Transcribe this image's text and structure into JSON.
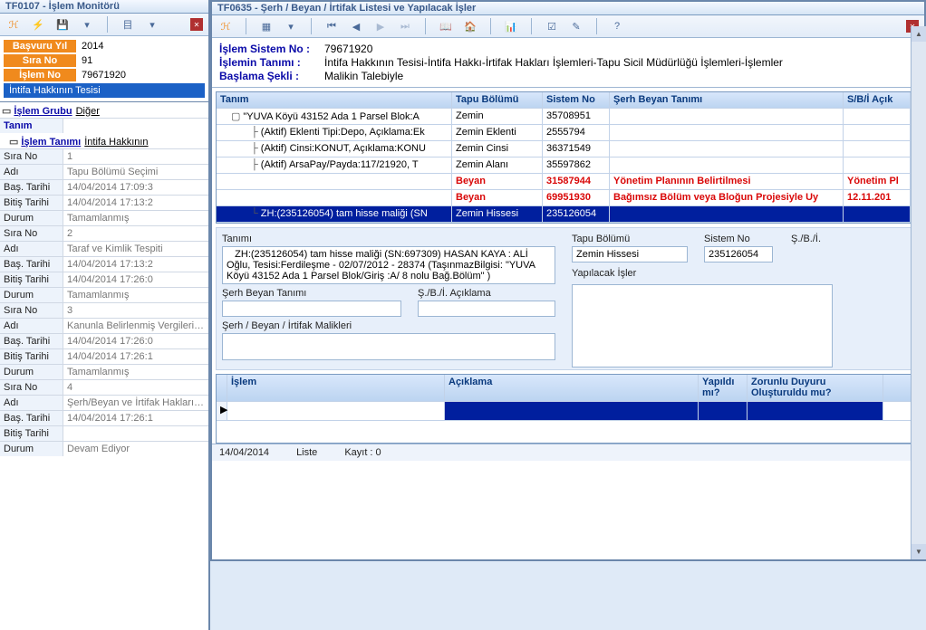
{
  "leftWindow": {
    "title": "TF0107 - İşlem Monitörü",
    "header": {
      "k1": "Başvuru Yıl",
      "v1": "2014",
      "k2": "Sıra No",
      "v2": "91",
      "k3": "İşlem No",
      "v3": "79671920",
      "statusBanner": "İntifa Hakkının Tesisi"
    },
    "groupLabel1": "İşlem Grubu",
    "groupVal1": "Diğer",
    "tanimKey": "Tanım",
    "groupLabel2": "İşlem Tanımı",
    "groupVal2": "İntifa Hakkının",
    "items": [
      {
        "f": [
          [
            "Sıra No",
            "1"
          ],
          [
            "Adı",
            "Tapu Bölümü Seçimi"
          ],
          [
            "Baş. Tarihi",
            "14/04/2014 17:09:3"
          ],
          [
            "Bitiş Tarihi",
            "14/04/2014 17:13:2"
          ],
          [
            "Durum",
            "Tamamlanmış"
          ]
        ]
      },
      {
        "f": [
          [
            "Sıra No",
            "2"
          ],
          [
            "Adı",
            "Taraf ve Kimlik Tespiti"
          ],
          [
            "Baş. Tarihi",
            "14/04/2014 17:13:2"
          ],
          [
            "Bitiş Tarihi",
            "14/04/2014 17:26:0"
          ],
          [
            "Durum",
            "Tamamlanmış"
          ]
        ]
      },
      {
        "f": [
          [
            "Sıra No",
            "3"
          ],
          [
            "Adı",
            "Kanunla Belirlenmiş Vergilerin Kontrolü"
          ],
          [
            "Baş. Tarihi",
            "14/04/2014 17:26:0"
          ],
          [
            "Bitiş Tarihi",
            "14/04/2014 17:26:1"
          ],
          [
            "Durum",
            "Tamamlanmış"
          ]
        ]
      },
      {
        "f": [
          [
            "Sıra No",
            "4"
          ],
          [
            "Adı",
            "Şerh/Beyan ve İrtifak Hakları Kontrolü"
          ],
          [
            "Baş. Tarihi",
            "14/04/2014 17:26:1"
          ],
          [
            "Bitiş Tarihi",
            ""
          ],
          [
            "Durum",
            "Devam Ediyor"
          ]
        ]
      }
    ]
  },
  "rightWindow": {
    "title": "TF0635 - Şerh / Beyan / İrtifak Listesi ve Yapılacak İşler",
    "info": {
      "r1k": "İşlem Sistem No :",
      "r1v": "79671920",
      "r2k": "İşlemin Tanımı :",
      "r2v": "İntifa Hakkının Tesisi-İntifa Hakkı-İrtifak Hakları İşlemleri-Tapu Sicil Müdürlüğü İşlemleri-İşlemler",
      "r3k": "Başlama Şekli :",
      "r3v": "Malikin Talebiyle"
    },
    "gridHead": {
      "c1": "Tanım",
      "c2": "Tapu Bölümü",
      "c3": "Sistem No",
      "c4": "Şerh Beyan Tanımı",
      "c5": "S/B/İ Açık"
    },
    "gridRows": [
      {
        "indent": 0,
        "glyph": "▢",
        "t": "\"YUVA Köyü 43152 Ada 1 Parsel Blok:A",
        "b": "Zemin",
        "s": "35708951",
        "d": "",
        "a": ""
      },
      {
        "indent": 1,
        "glyph": "├",
        "t": "(Aktif) Eklenti Tipi:Depo, Açıklama:Ek",
        "b": "Zemin Eklenti",
        "s": "2555794",
        "d": "",
        "a": ""
      },
      {
        "indent": 1,
        "glyph": "├",
        "t": "(Aktif) Cinsi:KONUT, Açıklama:KONU",
        "b": "Zemin Cinsi",
        "s": "36371549",
        "d": "",
        "a": ""
      },
      {
        "indent": 1,
        "glyph": "├",
        "t": "(Aktif) ArsaPay/Payda:117/21920, T",
        "b": "Zemin Alanı",
        "s": "35597862",
        "d": "",
        "a": ""
      },
      {
        "indent": 1,
        "glyph": "",
        "t": "",
        "b": "Beyan",
        "s": "31587944",
        "d": "Yönetim Planının Belirtilmesi",
        "a": "Yönetim Pl",
        "red": true
      },
      {
        "indent": 1,
        "glyph": "",
        "t": "",
        "b": "Beyan",
        "s": "69951930",
        "d": "Bağımsız Bölüm veya Bloğun Projesiyle Uy",
        "a": "12.11.201",
        "red": true
      },
      {
        "indent": 1,
        "glyph": "└",
        "t": "ZH:(235126054) tam hisse maliği (SN",
        "b": "Zemin Hissesi",
        "s": "235126054",
        "d": "",
        "a": "",
        "sel": true
      }
    ],
    "detail": {
      "tanimLbl": "Tanımı",
      "tanimVal": "   ZH:(235126054) tam hisse maliği (SN:697309) HASAN KAYA : ALİ Oğlu, Tesisi:Ferdileşme - 02/07/2012 - 28374 (TaşınmazBilgisi: \"YUVA Köyü 43152 Ada 1 Parsel Blok/Giriş :A/ 8 nolu Bağ.Bölüm\" )",
      "tapuLbl": "Tapu Bölümü",
      "tapuVal": "Zemin Hissesi",
      "sysLbl": "Sistem No",
      "sysVal": "235126054",
      "sbiLbl": "Ş./B./İ.",
      "yapLbl": "Yapılacak İşler",
      "serhLbl": "Şerh Beyan Tanımı",
      "sbiAcLbl": "Ş./B./İ. Açıklama",
      "malLbl": "Şerh / Beyan / İrtifak Malikleri"
    },
    "bottomHead": {
      "c1": "İşlem",
      "c2": "Açıklama",
      "c3": "Yapıldı mı?",
      "c4": "Zorunlu Duyuru Oluşturuldu mu?"
    },
    "statusBar": {
      "a": "14/04/2014",
      "b": "Liste",
      "c": "Kayıt : 0"
    }
  }
}
